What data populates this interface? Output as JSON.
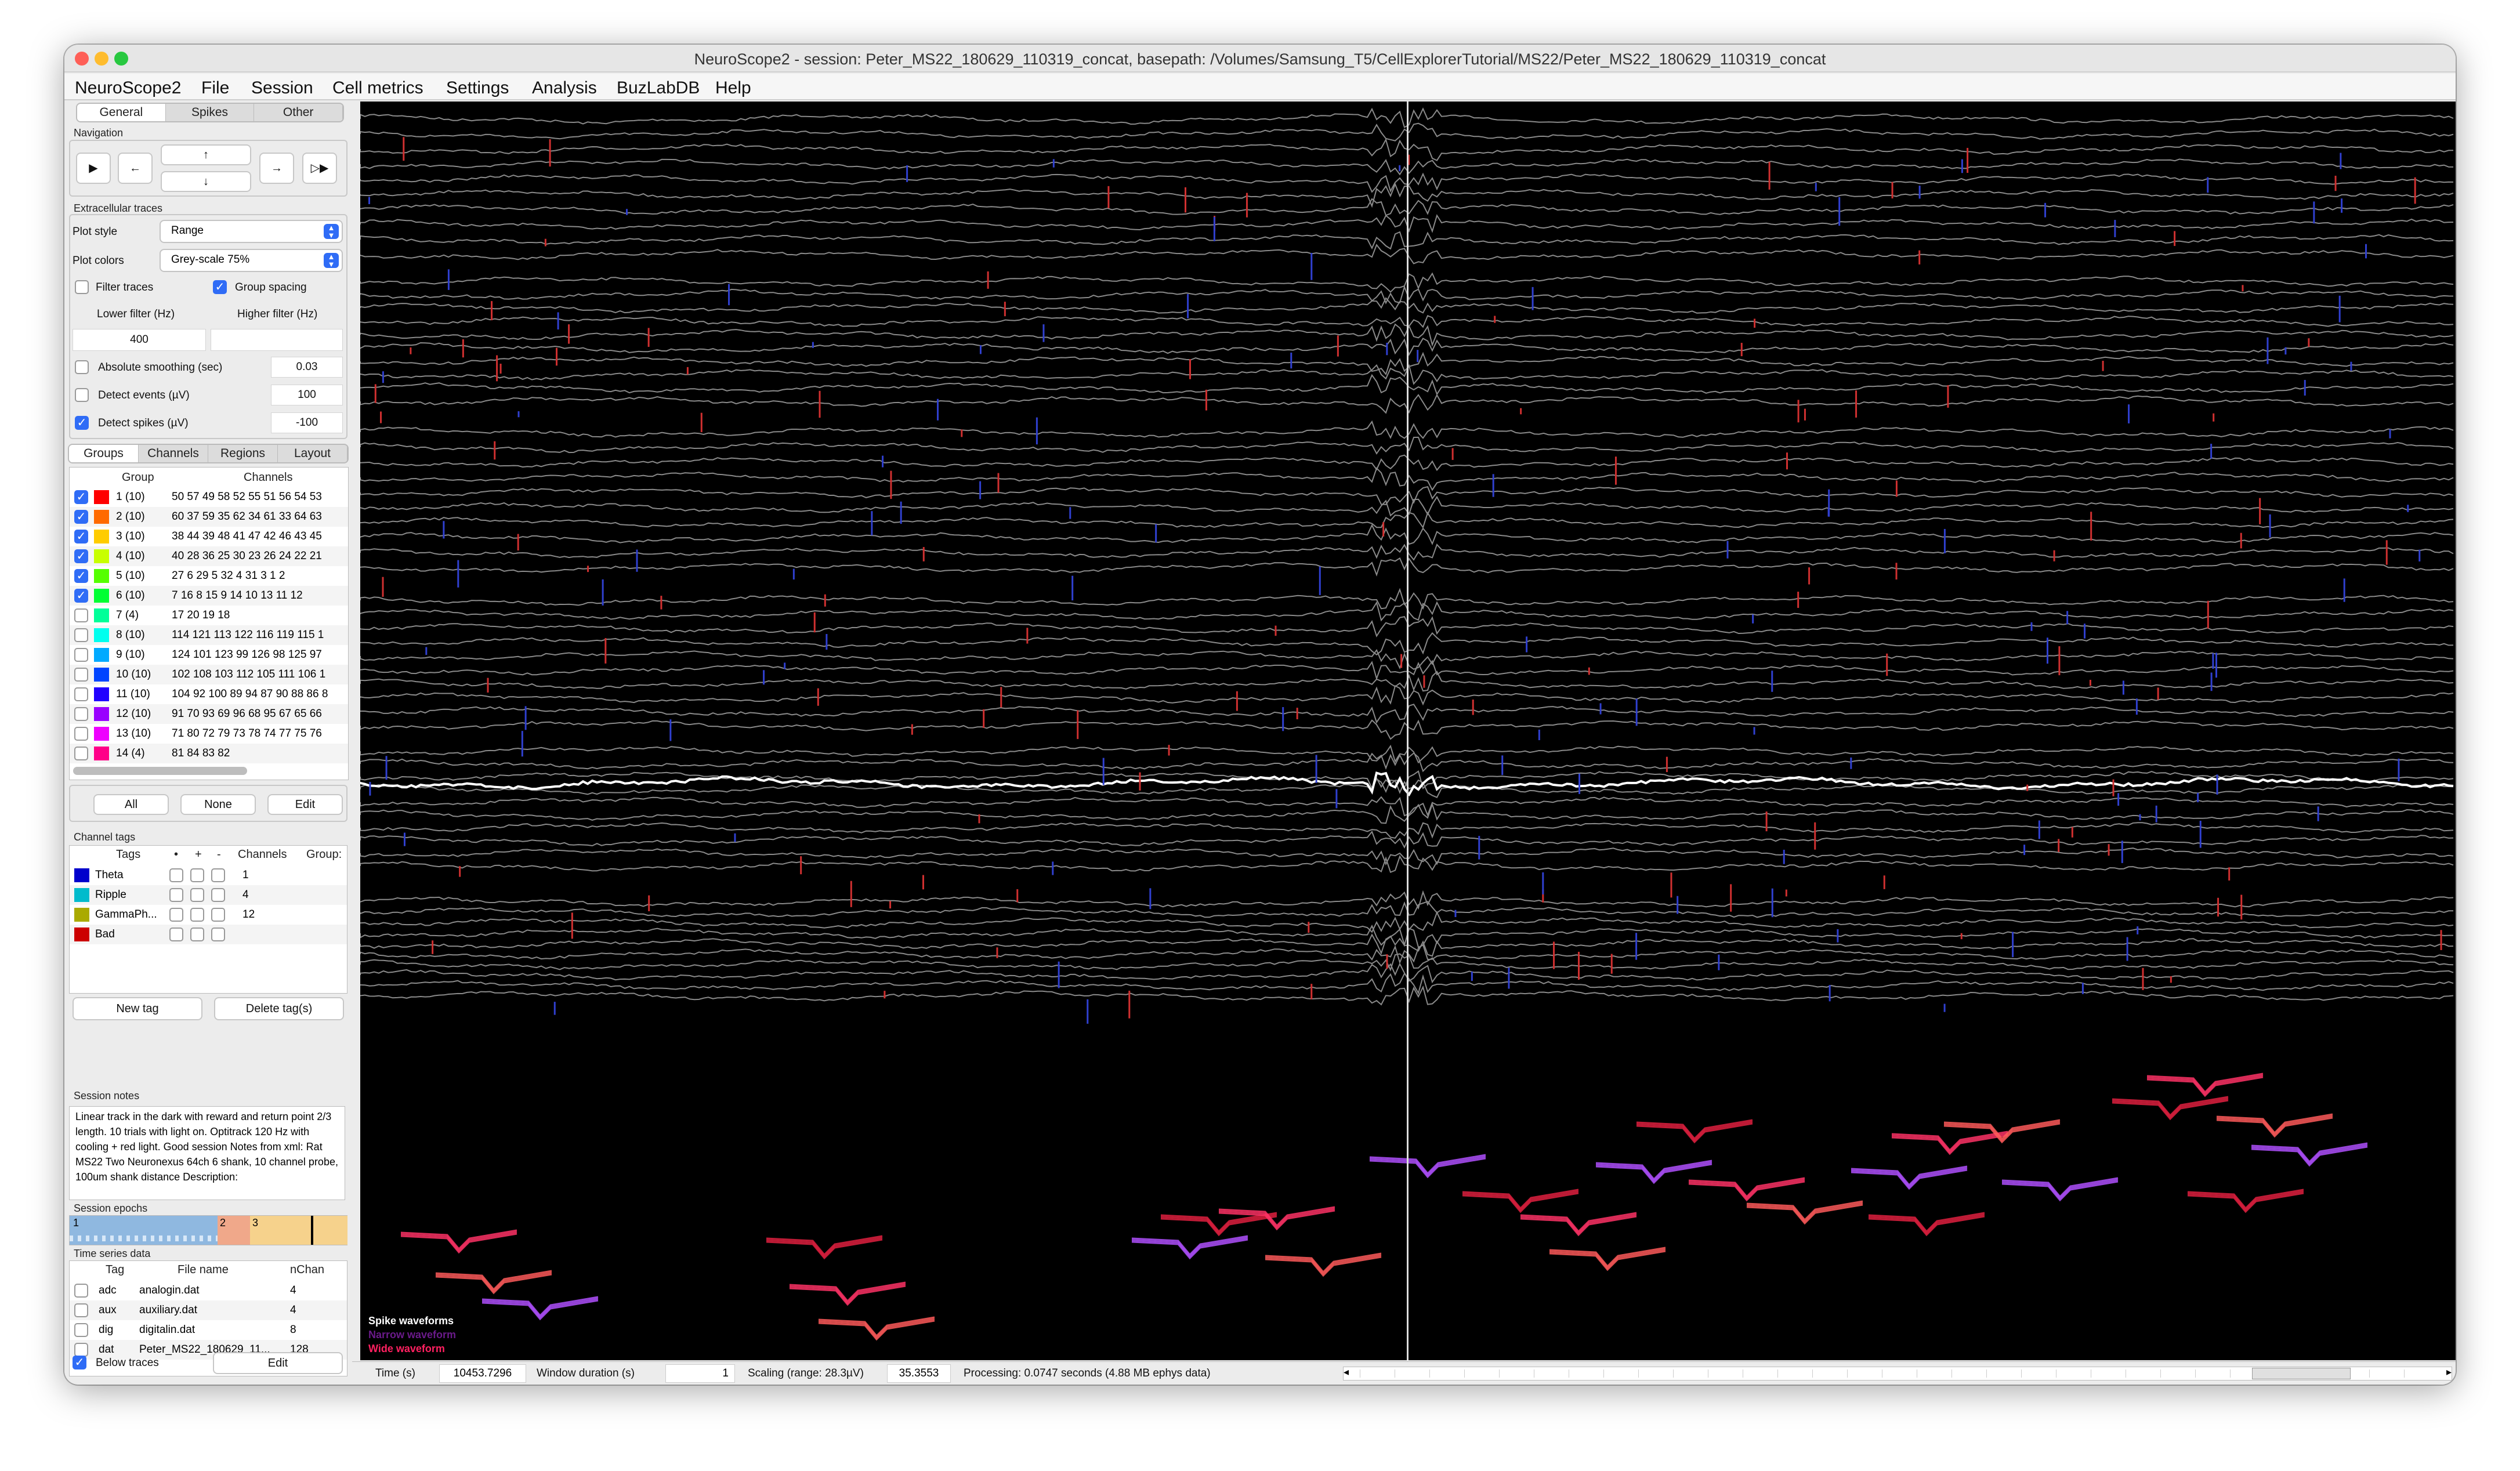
{
  "window": {
    "title": "NeuroScope2   -   session: Peter_MS22_180629_110319_concat, basepath: /Volumes/Samsung_T5/CellExplorerTutorial/MS22/Peter_MS22_180629_110319_concat"
  },
  "menu": [
    "NeuroScope2",
    "File",
    "Session",
    "Cell metrics",
    "Settings",
    "Analysis",
    "BuzLabDB",
    "Help"
  ],
  "main_tabs": [
    "General",
    "Spikes",
    "Other"
  ],
  "navigation": {
    "label": "Navigation",
    "play": "▶",
    "left": "←",
    "up": "↑",
    "down": "↓",
    "right": "→",
    "fast": "▷▶"
  },
  "traces": {
    "label": "Extracellular traces",
    "plot_style_label": "Plot style",
    "plot_style": "Range",
    "plot_colors_label": "Plot colors",
    "plot_colors": "Grey-scale 75%",
    "filter_traces": "Filter traces",
    "group_spacing": "Group spacing",
    "lower_filter_label": "Lower filter (Hz)",
    "higher_filter_label": "Higher filter (Hz)",
    "lower_filter": "400",
    "higher_filter": "",
    "abs_smoothing_label": "Absolute smoothing (sec)",
    "abs_smoothing": "0.03",
    "detect_events_label": "Detect events (µV)",
    "detect_events": "100",
    "detect_spikes_label": "Detect spikes (µV)",
    "detect_spikes": "-100"
  },
  "group_tabs": [
    "Groups",
    "Channels",
    "Regions",
    "Layout"
  ],
  "groups": {
    "headers": [
      "Group",
      "Channels"
    ],
    "rows": [
      {
        "group": "1 (10)",
        "channels": "50 57 49 58 52 55 51 56 54 53",
        "color": "#ff0000",
        "checked": true
      },
      {
        "group": "2 (10)",
        "channels": "60 37 59 35 62 34 61 33 64 63",
        "color": "#ff6a00",
        "checked": true
      },
      {
        "group": "3 (10)",
        "channels": "38 44 39 48 41 47 42 46 43 45",
        "color": "#ffcc00",
        "checked": true
      },
      {
        "group": "4 (10)",
        "channels": "40 28 36 25 30 23 26 24 22 21",
        "color": "#c8ff00",
        "checked": true
      },
      {
        "group": "5 (10)",
        "channels": "27 6 29 5 32 4 31 3 1 2",
        "color": "#55ff00",
        "checked": true
      },
      {
        "group": "6 (10)",
        "channels": "7 16 8 15 9 14 10 13 11 12",
        "color": "#00ff33",
        "checked": true
      },
      {
        "group": "7 (4)",
        "channels": "17 20 19 18",
        "color": "#00ff99",
        "checked": false
      },
      {
        "group": "8 (10)",
        "channels": "114 121 113 122 116 119 115 1",
        "color": "#00ffee",
        "checked": false
      },
      {
        "group": "9 (10)",
        "channels": "124 101 123 99 126 98 125 97",
        "color": "#00aaff",
        "checked": false
      },
      {
        "group": "10 (10)",
        "channels": "102 108 103 112 105 111 106 1",
        "color": "#0044ff",
        "checked": false
      },
      {
        "group": "11 (10)",
        "channels": "104 92 100 89 94 87 90 88 86 8",
        "color": "#2200ff",
        "checked": false
      },
      {
        "group": "12 (10)",
        "channels": "91 70 93 69 96 68 95 67 65 66",
        "color": "#9900ff",
        "checked": false
      },
      {
        "group": "13 (10)",
        "channels": "71 80 72 79 73 78 74 77 75 76",
        "color": "#ee00ff",
        "checked": false
      },
      {
        "group": "14 (4)",
        "channels": "81 84 83 82",
        "color": "#ff0088",
        "checked": false
      }
    ]
  },
  "group_buttons": {
    "all": "All",
    "none": "None",
    "edit": "Edit"
  },
  "channel_tags": {
    "label": "Channel tags",
    "headers": [
      "Tags",
      "•",
      "+",
      "-",
      "Channels",
      "Group:"
    ],
    "rows": [
      {
        "tag": "Theta",
        "channels": "1",
        "color": "#0000cc"
      },
      {
        "tag": "Ripple",
        "channels": "4",
        "color": "#00bbcc"
      },
      {
        "tag": "GammaPh...",
        "channels": "12",
        "color": "#aaaa00"
      },
      {
        "tag": "Bad",
        "channels": "",
        "color": "#cc0000"
      }
    ],
    "new_tag": "New tag",
    "delete_tag": "Delete tag(s)"
  },
  "session_notes": {
    "label": "Session notes",
    "text": "Linear track in the dark with reward and return point 2/3 length. 10 trials with light on. Optitrack 120 Hz with cooling + red light. Good session   Notes from xml: Rat MS22 Two Neuronexus 64ch 6 shank, 10 channel probe, 100um shank distance   Description:"
  },
  "session_epochs": {
    "label": "Session epochs",
    "epochs": [
      "1",
      "2",
      "3"
    ]
  },
  "time_series": {
    "label": "Time series data",
    "headers": [
      "Tag",
      "File name",
      "nChan"
    ],
    "rows": [
      {
        "tag": "adc",
        "file": "analogin.dat",
        "n": "4"
      },
      {
        "tag": "aux",
        "file": "auxiliary.dat",
        "n": "4"
      },
      {
        "tag": "dig",
        "file": "digitalin.dat",
        "n": "8"
      },
      {
        "tag": "dat",
        "file": "Peter_MS22_180629_11...",
        "n": "128"
      }
    ]
  },
  "below_traces": "Below traces",
  "below_edit": "Edit",
  "plot_legend": {
    "spike": "Spike waveforms",
    "narrow": "Narrow waveform",
    "wide": "Wide waveform"
  },
  "status": {
    "time_label": "Time (s)",
    "time": "10453.7296",
    "window_label": "Window duration (s)",
    "window": "1",
    "scaling_label": "Scaling (range: 28.3µV)",
    "scaling": "35.3553",
    "processing": "Processing: 0.0747 seconds (4.88 MB ephys data)"
  }
}
